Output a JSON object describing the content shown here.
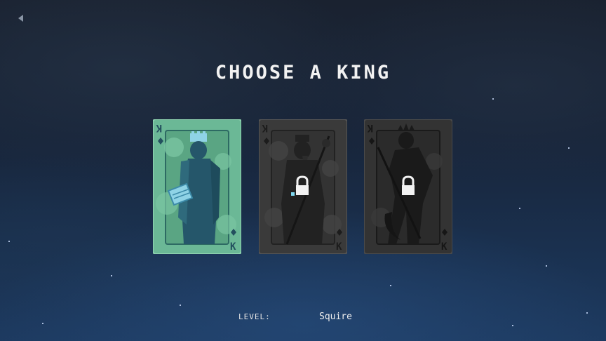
{
  "screen": {
    "title": "CHOOSE A KING",
    "back_icon": "back-arrow-icon"
  },
  "cards": [
    {
      "rank": "K",
      "suit": "diamond",
      "locked": false,
      "selected": true,
      "colors": {
        "face": "#6bb896",
        "figure": "#25566a"
      }
    },
    {
      "rank": "K",
      "suit": "diamond",
      "locked": true,
      "selected": false,
      "colors": {
        "face": "#3a3a3a",
        "figure": "#1f1f1f"
      }
    },
    {
      "rank": "K",
      "suit": "diamond",
      "locked": true,
      "selected": false,
      "colors": {
        "face": "#333333",
        "figure": "#1a1a1a"
      }
    }
  ],
  "level": {
    "label": "LEVEL:",
    "value": "Squire"
  }
}
